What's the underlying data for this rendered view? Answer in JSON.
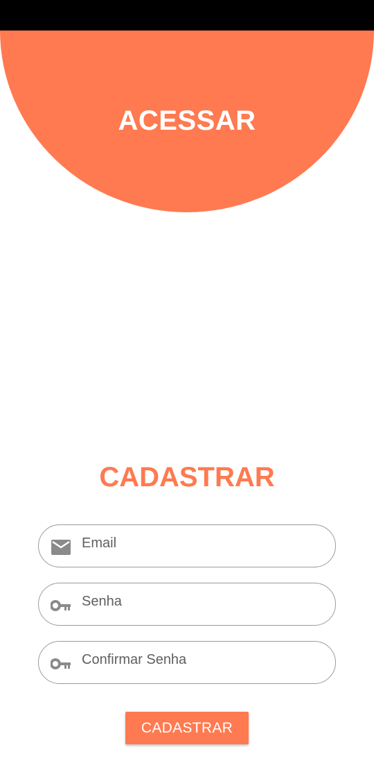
{
  "header": {
    "title": "ACESSAR"
  },
  "form": {
    "title": "CADASTRAR",
    "fields": [
      {
        "name": "email",
        "placeholder": "Email",
        "value": "",
        "icon": "mail-icon"
      },
      {
        "name": "senha",
        "placeholder": "Senha",
        "value": "",
        "icon": "key-icon"
      },
      {
        "name": "confirmar-senha",
        "placeholder": "Confirmar Senha",
        "value": "",
        "icon": "key-icon"
      }
    ],
    "submit_label": "CADASTRAR"
  },
  "colors": {
    "accent": "#ff7a50",
    "status_bar": "#000000",
    "field_border": "#9a9a9a",
    "icon": "#8a8a8a"
  }
}
